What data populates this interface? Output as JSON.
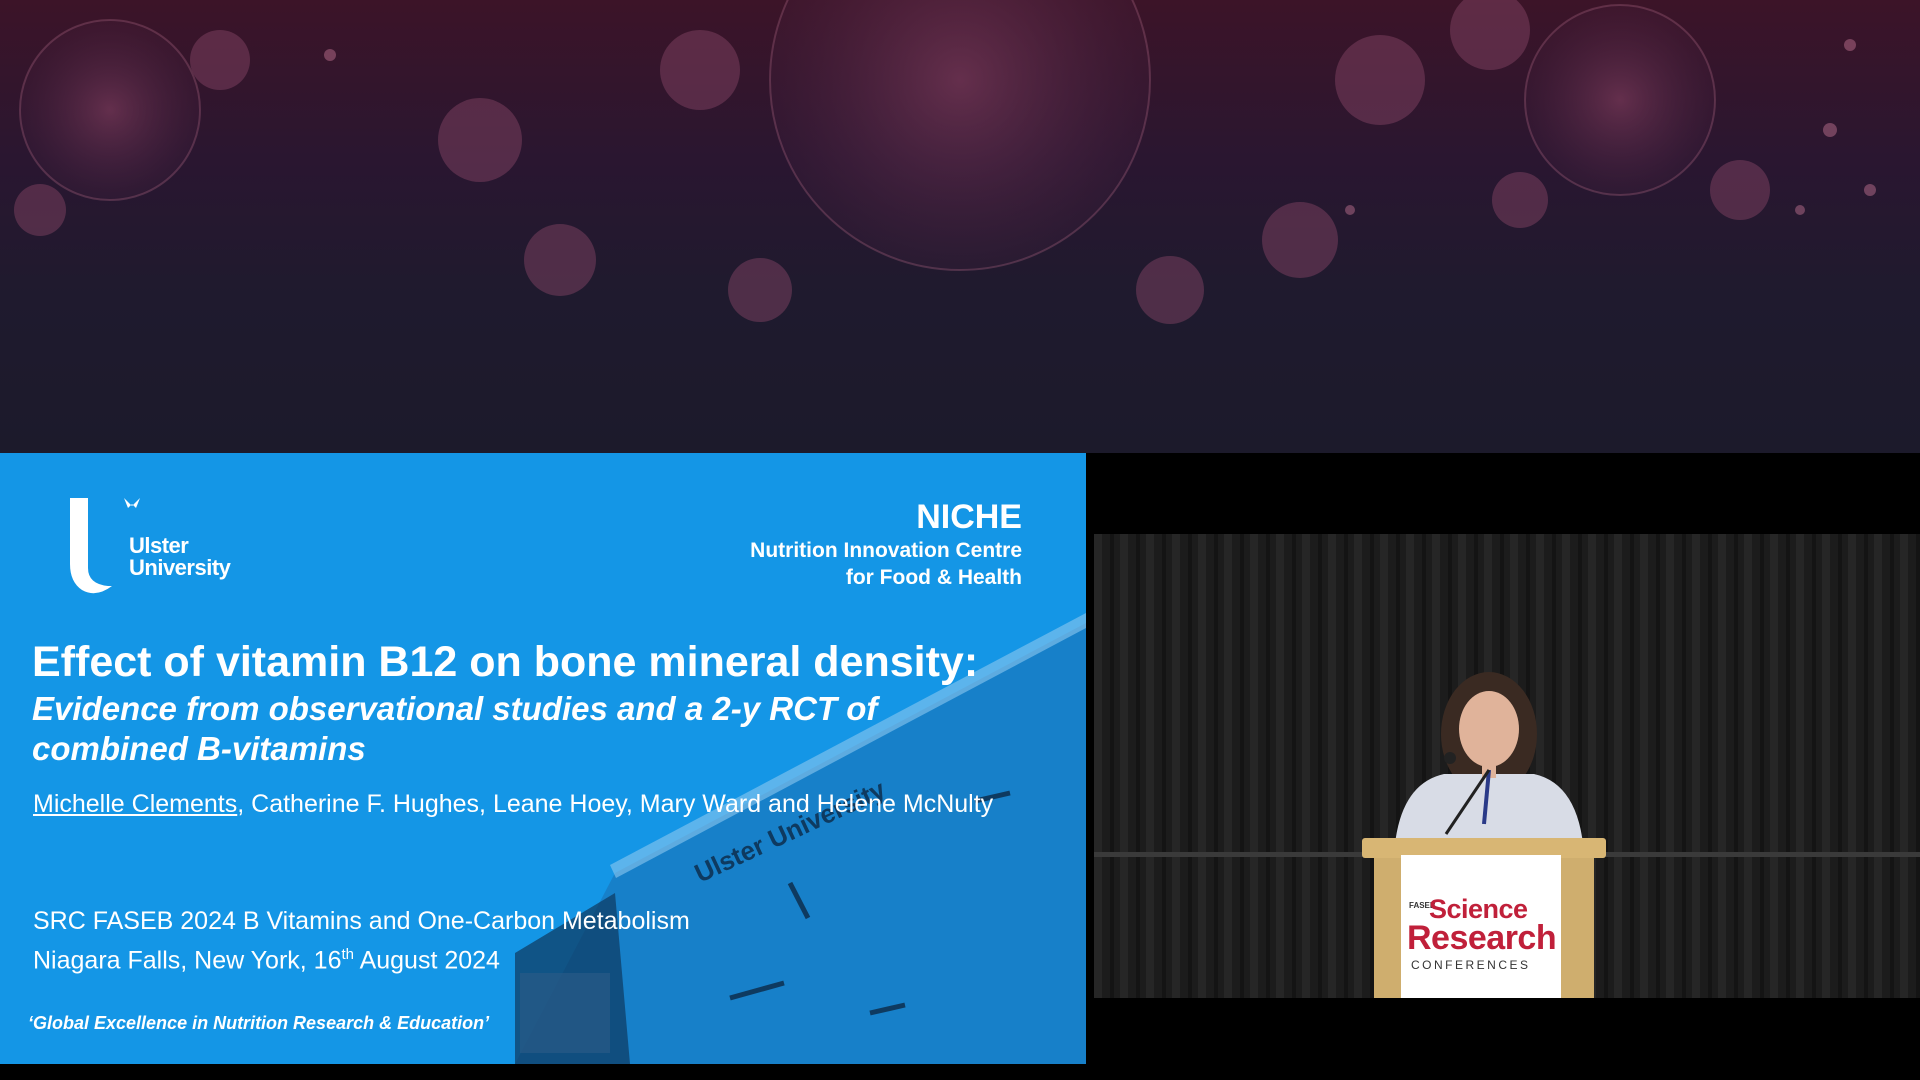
{
  "slide": {
    "logo_line1": "Ulster",
    "logo_line2": "University",
    "niche_title": "NICHE",
    "niche_line1": "Nutrition Innovation Centre",
    "niche_line2": "for Food & Health",
    "title": "Effect of vitamin B12 on bone mineral density:",
    "subtitle": "Evidence from observational studies and a 2-y RCT of combined B-vitamins",
    "presenter": "Michelle Clements",
    "coauthors": ", Catherine F. Hughes, Leane Hoey, Mary Ward and Helene McNulty",
    "conference": "SRC FASEB 2024 B Vitamins and One-Carbon Metabolism",
    "location_prefix": "Niagara Falls, New York, 16",
    "date_suffix": "th",
    "date_rest": " August 2024",
    "motto": "‘Global Excellence in Nutrition Research & Education’",
    "building_sign": "Ulster University"
  },
  "video": {
    "podium_faseb": "FASEB",
    "podium_science": "Science",
    "podium_research": "Research",
    "podium_conferences": "CONFERENCES"
  },
  "colors": {
    "slide_bg": "#1496e6",
    "banner_bg": "#1f1a2e",
    "podium_red": "#c0203a"
  }
}
